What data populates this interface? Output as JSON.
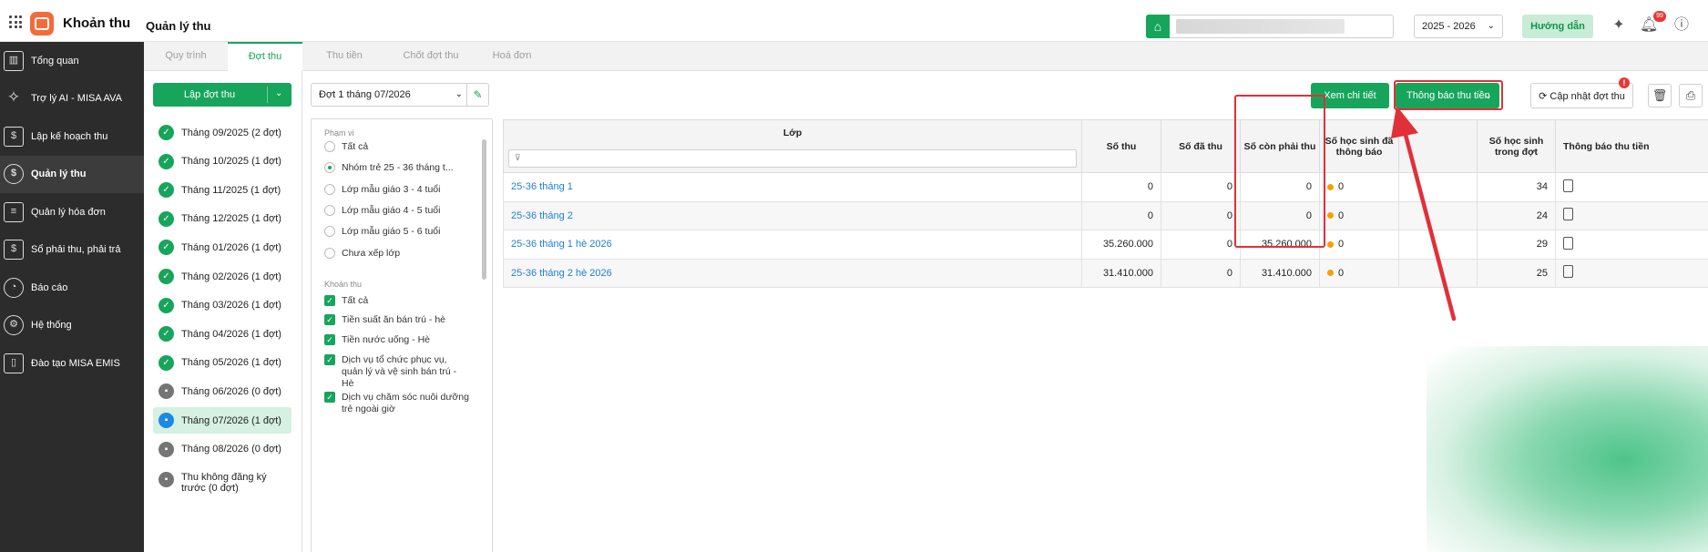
{
  "app": {
    "name": "Khoản thu",
    "page_title": "Quản lý thu"
  },
  "header": {
    "year": "2025 - 2026",
    "guide_label": "Hướng dẫn",
    "notification_count": "99"
  },
  "sidebar": {
    "items": [
      {
        "label": "Tổng quan",
        "icon": "chart-icon"
      },
      {
        "label": "Trợ lý AI - MISA AVA",
        "icon": "sparkle-icon"
      },
      {
        "label": "Lập kế hoạch thu",
        "icon": "calendar-icon"
      },
      {
        "label": "Quản lý thu",
        "icon": "money-hand-icon",
        "active": true
      },
      {
        "label": "Quản lý hóa đơn",
        "icon": "invoice-icon"
      },
      {
        "label": "Sổ phải thu, phải trả",
        "icon": "ledger-icon"
      },
      {
        "label": "Báo cáo",
        "icon": "pie-chart-icon"
      },
      {
        "label": "Hệ thống",
        "icon": "gear-icon"
      },
      {
        "label": "Đào tạo MISA EMIS",
        "icon": "book-icon"
      }
    ]
  },
  "tabs": [
    "Quy trình",
    "Đợt thu",
    "Thu tiền",
    "Chốt đợt thu",
    "Hoá đơn"
  ],
  "active_tab": "Đợt thu",
  "months": {
    "create_label": "Lập đợt thu",
    "items": [
      {
        "label": "Tháng 09/2025 (2 đợt)",
        "status": "done"
      },
      {
        "label": "Tháng 10/2025 (1 đợt)",
        "status": "done"
      },
      {
        "label": "Tháng 11/2025 (1 đợt)",
        "status": "done"
      },
      {
        "label": "Tháng 12/2025 (1 đợt)",
        "status": "done"
      },
      {
        "label": "Tháng 01/2026 (1 đợt)",
        "status": "done"
      },
      {
        "label": "Tháng 02/2026 (1 đợt)",
        "status": "done"
      },
      {
        "label": "Tháng 03/2026 (1 đợt)",
        "status": "done"
      },
      {
        "label": "Tháng 04/2026 (1 đợt)",
        "status": "done"
      },
      {
        "label": "Tháng 05/2026 (1 đợt)",
        "status": "done"
      },
      {
        "label": "Tháng 06/2026 (0 đợt)",
        "status": "empty"
      },
      {
        "label": "Tháng 07/2026 (1 đợt)",
        "status": "selected"
      },
      {
        "label": "Tháng 08/2026 (0 đợt)",
        "status": "empty"
      }
    ],
    "unregistered_line1": "Thu không đăng ký",
    "unregistered_line2": "trước (0 đợt)"
  },
  "batch_select": "Đợt 1 tháng 07/2026",
  "filters": {
    "scope_title": "Phạm vi",
    "scope": [
      {
        "label": "Tất cả",
        "on": false
      },
      {
        "label": "Nhóm trẻ 25 - 36 tháng t...",
        "on": true
      },
      {
        "label": "Lớp mẫu giáo 3 - 4 tuổi",
        "on": false
      },
      {
        "label": "Lớp mẫu giáo 4 - 5 tuổi",
        "on": false
      },
      {
        "label": "Lớp mẫu giáo 5 - 6 tuổi",
        "on": false
      },
      {
        "label": "Chưa xếp lớp",
        "on": false
      }
    ],
    "fees_title": "Khoản thu",
    "fees": [
      "Tất cả",
      "Tiền suất ăn bán trú - hè",
      "Tiền nước uống - Hè",
      "Dịch vụ tổ chức phục vụ, quản lý và vệ sinh bán trú - Hè",
      "Dịch vụ chăm sóc nuôi dưỡng trẻ ngoài giờ"
    ]
  },
  "actions": {
    "detail": "Xem chi tiết",
    "notify": "Thông báo thu tiền",
    "update": "Cập nhật đợt thu",
    "alert_mark": "!"
  },
  "table": {
    "headers": {
      "class": "Lớp",
      "total": "Số thu",
      "paid": "Số đã thu",
      "remaining": "Số còn phải thu",
      "notified": "Số học sinh đã thông báo",
      "students": "Số học sinh trong đợt",
      "notice": "Thông báo thu tiền"
    },
    "rows": [
      {
        "class": "25-36 tháng 1",
        "total": "0",
        "paid": "0",
        "remaining": "0",
        "notified": "0",
        "students": "34"
      },
      {
        "class": "25-36 tháng 2",
        "total": "0",
        "paid": "0",
        "remaining": "0",
        "notified": "0",
        "students": "24"
      },
      {
        "class": "25-36 tháng 1 hè 2026",
        "total": "35.260.000",
        "paid": "0",
        "remaining": "35.260.000",
        "notified": "0",
        "students": "29"
      },
      {
        "class": "25-36 tháng 2 hè 2026",
        "total": "31.410.000",
        "paid": "0",
        "remaining": "31.410.000",
        "notified": "0",
        "students": "25"
      }
    ]
  },
  "colors": {
    "brand": "#17a55c",
    "highlight": "#e0303a",
    "link": "#1e7fd6",
    "pending": "#f5a000"
  }
}
